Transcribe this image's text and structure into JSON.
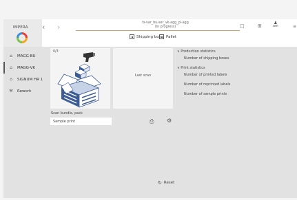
{
  "brand": {
    "name": "IMPERA"
  },
  "header": {
    "title": "fs-var_bu-ser_vk-agg_pl-agg",
    "status": "(In progress)",
    "tabs": [
      {
        "label": "Shipping box"
      },
      {
        "label": "Pallet"
      }
    ],
    "user_label": "am"
  },
  "sidebar": {
    "items": [
      {
        "label": "MAGG-BU"
      },
      {
        "label": "MAGG-VK"
      },
      {
        "label": "SIGNUM HR 1"
      },
      {
        "label": "Rework"
      }
    ]
  },
  "pack": {
    "count": "0/3"
  },
  "last_scan": {
    "label": "Last scan"
  },
  "stats": {
    "production_header": "Production statistics",
    "production_items": [
      "Number of shipping boxes"
    ],
    "print_header": "Print statistics",
    "print_items": [
      "Number of printed labels",
      "Number of reprinted labels",
      "Number of sample prints"
    ]
  },
  "bundle": {
    "label": "Scan bundle, pack"
  },
  "sample": {
    "value": "Sample print"
  },
  "reset": {
    "label": "Reset"
  },
  "colors": {
    "accent_line": "#c9a06c",
    "background": "#e2e2e2",
    "card": "#f4f4f4"
  }
}
